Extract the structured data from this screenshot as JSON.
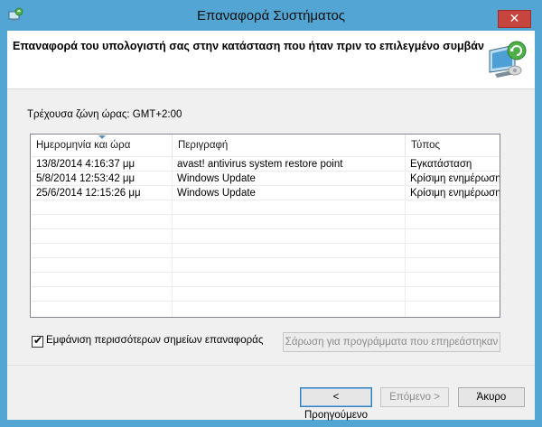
{
  "window": {
    "title": "Επαναφορά Συστήματος",
    "close_label": "✕"
  },
  "header": {
    "title": "Επαναφορά του υπολογιστή σας στην κατάσταση που ήταν πριν το επιλεγμένο συμβάν"
  },
  "timezone_label": "Τρέχουσα ζώνη ώρας: GMT+2:00",
  "list": {
    "columns": [
      "Ημερομηνία και ώρα",
      "Περιγραφή",
      "Τύπος"
    ],
    "rows": [
      {
        "date": "13/8/2014 4:16:37 μμ",
        "description": "avast! antivirus system restore point",
        "type": "Εγκατάσταση"
      },
      {
        "date": "5/8/2014 12:53:42 μμ",
        "description": "Windows Update",
        "type": "Κρίσιμη ενημέρωση"
      },
      {
        "date": "25/6/2014 12:15:26 μμ",
        "description": "Windows Update",
        "type": "Κρίσιμη ενημέρωση"
      }
    ]
  },
  "show_more": {
    "label": "Εμφάνιση περισσότερων σημείων επαναφοράς",
    "checked": true
  },
  "buttons": {
    "scan": "Σάρωση για προγράμματα που επηρεάστηκαν",
    "back": "< Προηγούμενο",
    "next": "Επόμενο >",
    "cancel": "Άκυρο"
  },
  "icons": {
    "title_icon": "system-restore-icon",
    "header_icon": "computer-restore-icon"
  },
  "colors": {
    "titlebar": "#53a5d3",
    "close": "#c7453f"
  }
}
